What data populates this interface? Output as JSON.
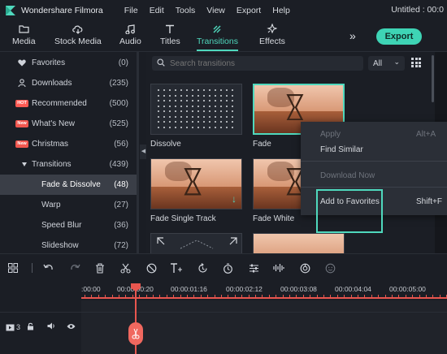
{
  "app": {
    "name": "Wondershare Filmora",
    "title": "Untitled : 00:0",
    "menus": [
      "File",
      "Edit",
      "Tools",
      "View",
      "Export",
      "Help"
    ]
  },
  "toolbar": {
    "tabs": [
      {
        "label": "Media",
        "icon": "folder-icon"
      },
      {
        "label": "Stock Media",
        "icon": "cloud-download-icon"
      },
      {
        "label": "Audio",
        "icon": "music-note-icon"
      },
      {
        "label": "Titles",
        "icon": "text-t-icon"
      },
      {
        "label": "Transitions",
        "icon": "transition-icon",
        "active": true
      },
      {
        "label": "Effects",
        "icon": "sparkle-icon"
      }
    ],
    "expand_glyph": "»",
    "export_label": "Export"
  },
  "sidebar": {
    "items": [
      {
        "label": "Favorites",
        "count": "(0)",
        "icon": "heart-icon"
      },
      {
        "label": "Downloads",
        "count": "(235)",
        "icon": "user-download-icon"
      },
      {
        "label": "Recommended",
        "count": "(500)",
        "badge": "HOT"
      },
      {
        "label": "What's New",
        "count": "(525)",
        "badge": "New"
      },
      {
        "label": "Christmas",
        "count": "(56)",
        "badge": "New"
      },
      {
        "label": "Transitions",
        "count": "(439)",
        "icon": "collapse-triangle-icon"
      },
      {
        "label": "Fade & Dissolve",
        "count": "(48)",
        "selected": true
      },
      {
        "label": "Warp",
        "count": "(27)"
      },
      {
        "label": "Speed Blur",
        "count": "(36)"
      },
      {
        "label": "Slideshow",
        "count": "(72)"
      }
    ]
  },
  "search": {
    "placeholder": "Search transitions",
    "filter_value": "All"
  },
  "grid": {
    "cards": [
      {
        "label": "Dissolve"
      },
      {
        "label": "Fade"
      },
      {
        "label": "Fade Single Track"
      },
      {
        "label": "Fade White"
      }
    ]
  },
  "context_menu": {
    "items": [
      {
        "label": "Apply",
        "shortcut": "Alt+A",
        "disabled": true
      },
      {
        "label": "Find Similar",
        "shortcut": ""
      },
      {
        "label": "Download Now",
        "shortcut": "",
        "disabled": true
      },
      {
        "label": "Add to Favorites",
        "shortcut": "Shift+F"
      }
    ]
  },
  "timeline": {
    "ruler_labels": [
      ":00:00",
      "00:00:00:20",
      "00:00:01:16",
      "00:00:02:12",
      "00:00:03:08",
      "00:00:04:04",
      "00:00:05:00"
    ],
    "track_label": "3"
  },
  "colors": {
    "accent": "#4fd8bd",
    "export_button": "#3ed4b5",
    "playhead": "#e8564f",
    "background": "#1b1e25"
  }
}
